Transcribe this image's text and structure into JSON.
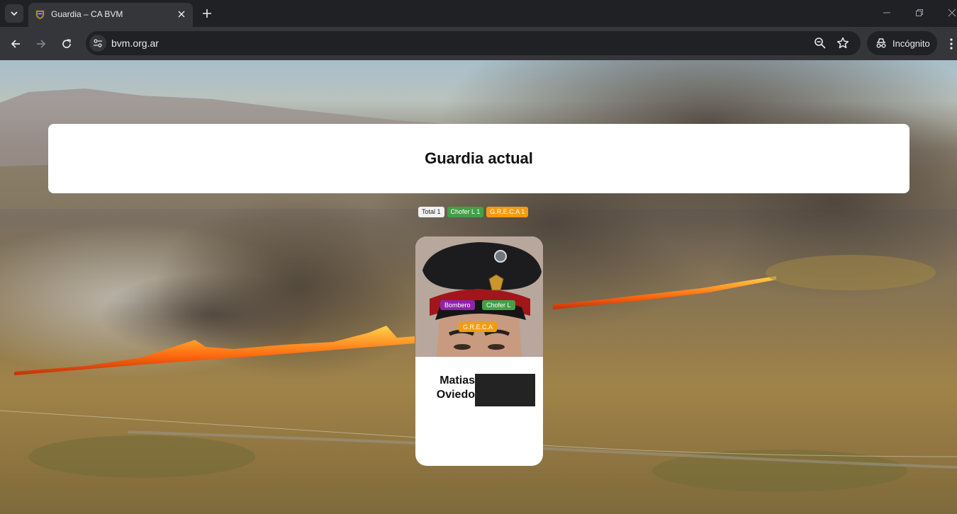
{
  "browser": {
    "tab": {
      "title": "Guardia – CA BVM"
    },
    "address_bar": {
      "url": "bvm.org.ar"
    },
    "incognito_label": "Incógnito"
  },
  "page": {
    "title": "Guardia actual",
    "counters": [
      {
        "label": "Total 1",
        "color": "#f1f1f1"
      },
      {
        "label": "Chofer L 1",
        "color": "#43a047"
      },
      {
        "label": "G.R.E.C.A 1",
        "color": "#f39c12"
      }
    ],
    "member": {
      "first_name": "Matias",
      "last_name": "Oviedo",
      "roles": [
        {
          "label": "Bombero",
          "color": "#8e24aa"
        },
        {
          "label": "Chofer L",
          "color": "#43a047"
        },
        {
          "label": "G.R.E.C.A",
          "color": "#f39c12"
        }
      ]
    }
  },
  "icons": [
    "tab-search-icon",
    "shield-favicon-icon",
    "close-icon",
    "plus-icon",
    "minimize-icon",
    "restore-icon",
    "window-close-icon",
    "back-icon",
    "forward-icon",
    "reload-icon",
    "site-settings-icon",
    "zoom-icon",
    "star-icon",
    "incognito-icon",
    "menu-icon"
  ]
}
